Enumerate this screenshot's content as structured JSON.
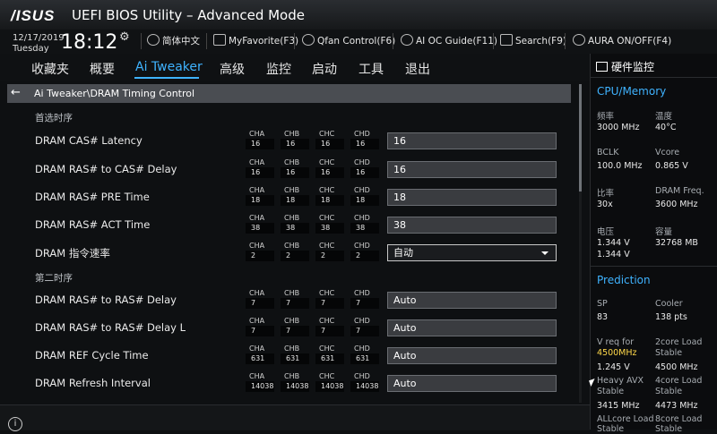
{
  "header": {
    "brand": "/ISUS",
    "title": "UEFI BIOS Utility – Advanced Mode",
    "date": "12/17/2019",
    "day": "Tuesday",
    "time": "18:12"
  },
  "toolbar": {
    "language": "简体中文",
    "myfavorite": "MyFavorite(F3)",
    "qfan": "Qfan Control(F6)",
    "aioc": "AI OC Guide(F11)",
    "search": "Search(F9)",
    "aura": "AURA ON/OFF(F4)"
  },
  "menu": {
    "items": [
      "收藏夹",
      "概要",
      "Ai Tweaker",
      "高级",
      "监控",
      "启动",
      "工具",
      "退出"
    ],
    "active_index": 2
  },
  "breadcrumb": "Ai Tweaker\\DRAM Timing Control",
  "channel_headers": [
    "CHA",
    "CHB",
    "CHC",
    "CHD"
  ],
  "sections": {
    "primary": "首选时序",
    "secondary": "第二时序"
  },
  "rows": [
    {
      "label": "DRAM CAS# Latency",
      "channels": [
        "16",
        "16",
        "16",
        "16"
      ],
      "value": "16",
      "type": "input"
    },
    {
      "label": "DRAM RAS# to CAS# Delay",
      "channels": [
        "16",
        "16",
        "16",
        "16"
      ],
      "value": "16",
      "type": "input"
    },
    {
      "label": "DRAM RAS# PRE Time",
      "channels": [
        "18",
        "18",
        "18",
        "18"
      ],
      "value": "18",
      "type": "input"
    },
    {
      "label": "DRAM RAS# ACT Time",
      "channels": [
        "38",
        "38",
        "38",
        "38"
      ],
      "value": "38",
      "type": "input"
    },
    {
      "label": "DRAM 指令速率",
      "channels": [
        "2",
        "2",
        "2",
        "2"
      ],
      "value": "自动",
      "type": "dropdown"
    },
    {
      "label": "DRAM RAS# to RAS# Delay",
      "channels": [
        "7",
        "7",
        "7",
        "7"
      ],
      "value": "Auto",
      "type": "input"
    },
    {
      "label": "DRAM RAS# to RAS# Delay L",
      "channels": [
        "7",
        "7",
        "7",
        "7"
      ],
      "value": "Auto",
      "type": "input"
    },
    {
      "label": "DRAM REF Cycle Time",
      "channels": [
        "631",
        "631",
        "631",
        "631"
      ],
      "value": "Auto",
      "type": "input"
    },
    {
      "label": "DRAM Refresh Interval",
      "channels": [
        "14038",
        "14038",
        "14038",
        "14038"
      ],
      "value": "Auto",
      "type": "input"
    }
  ],
  "hw": {
    "title": "硬件监控",
    "cpu_section": "CPU/Memory",
    "freq_label": "频率",
    "freq_value": "3000 MHz",
    "temp_label": "温度",
    "temp_value": "40°C",
    "bclk_label": "BCLK",
    "bclk_value": "100.0 MHz",
    "vcore_label": "Vcore",
    "vcore_value": "0.865 V",
    "ratio_label": "比率",
    "ratio_value": "30x",
    "dramfreq_label": "DRAM Freq.",
    "dramfreq_value": "3600 MHz",
    "volt_label": "电压",
    "volt_value1": "1.344 V",
    "volt_value2": "1.344 V",
    "cap_label": "容量",
    "cap_value": "32768 MB",
    "pred_section": "Prediction",
    "sp_label": "SP",
    "sp_value": "83",
    "cooler_label": "Cooler",
    "cooler_value": "138 pts",
    "vreq_label": "V req for",
    "vreq_freq": "4500MHz",
    "vreq_value": "1.245 V",
    "c2_label1": "2core Load",
    "c2_label2": "Stable",
    "c2_value": "4500 MHz",
    "avx_label1": "Heavy AVX",
    "avx_label2": "Stable",
    "avx_value": "3415 MHz",
    "c4_label1": "4core Load",
    "c4_label2": "Stable",
    "c4_value": "4473 MHz",
    "all_label1": "ALLcore Load",
    "all_label2": "Stable",
    "c8_label1": "8core Load",
    "c8_label2": "Stable"
  }
}
